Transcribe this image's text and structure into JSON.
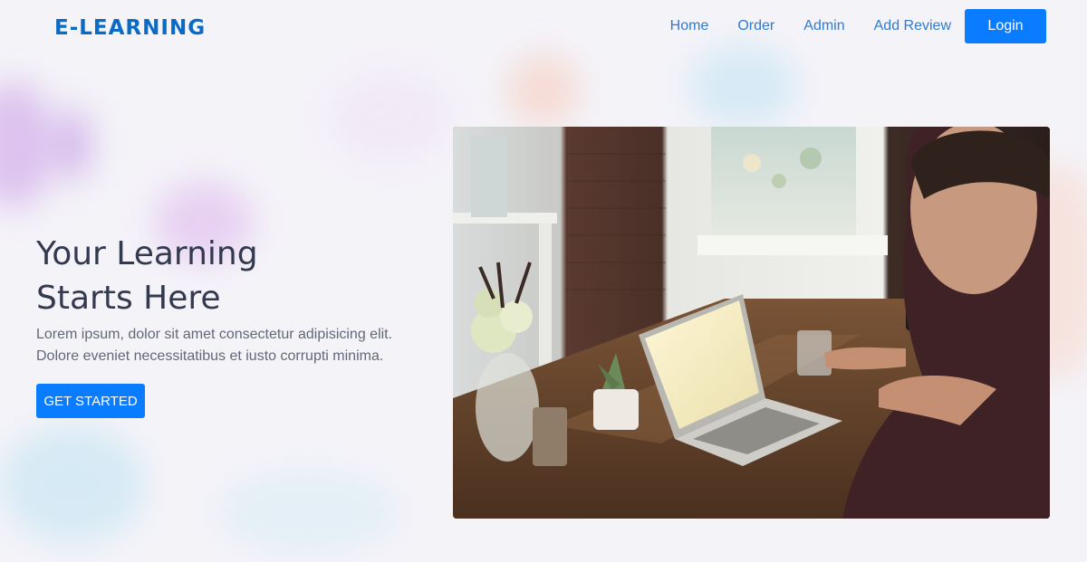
{
  "brand": {
    "name": "E-LEARNING"
  },
  "nav": {
    "items": [
      {
        "label": "Home"
      },
      {
        "label": "Order"
      },
      {
        "label": "Admin"
      },
      {
        "label": "Add Review"
      }
    ],
    "login_label": "Login"
  },
  "hero": {
    "title": "Your Learning Starts Here",
    "description": "Lorem ipsum, dolor sit amet consectetur adipisicing elit. Dolore eveniet necessitatibus et iusto corrupti minima.",
    "cta_label": "GET STARTED",
    "image_icon": "man-with-laptop-photo"
  },
  "colors": {
    "accent": "#0a7cff",
    "brand": "#0b6bc4",
    "nav_link": "#2f7bd0",
    "heading": "#333a4f",
    "body_text": "#626879"
  }
}
